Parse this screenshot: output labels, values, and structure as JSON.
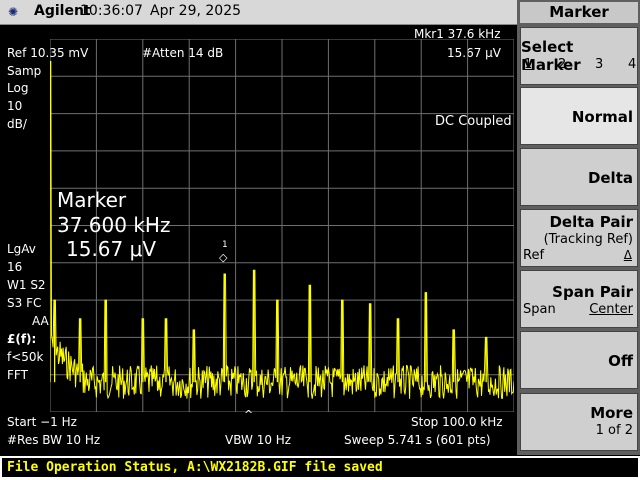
{
  "header": {
    "logo_icon": "agilent-spark-icon",
    "brand": "Agilent",
    "time": "10:36:07",
    "date": "Apr 29, 2025"
  },
  "analyzer": {
    "mkr_readout": "Mkr1  37.6 kHz",
    "ref_level": "Ref 10.35 mV",
    "atten": "#Atten 14 dB",
    "mkr_amplitude": "15.67 μV",
    "left_labels": [
      "Samp",
      "Log",
      "10",
      "dB/"
    ],
    "dc_coupled": "DC Coupled",
    "marker_title": "Marker",
    "marker_freq": "37.600 kHz",
    "marker_amp": "15.67 μV",
    "marker_id": "1",
    "lgav": "LgAv",
    "lgav_count": "16",
    "w1": "W1  S2",
    "s3": "S3  FC",
    "aa": "AA",
    "ff": "£(f):",
    "f50k": "f<50k",
    "fft": "FFT",
    "start": "Start −1 Hz",
    "stop": "Stop 100.0 kHz",
    "res_bw": "#Res BW 10 Hz",
    "vbw": "VBW 10 Hz",
    "sweep": "Sweep 5.741 s (601 pts)"
  },
  "chart_data": {
    "type": "line",
    "title": "",
    "xlabel": "",
    "ylabel": "",
    "x_unit": "kHz",
    "xlim": [
      0,
      100
    ],
    "y_divisions_from_top": [
      0,
      10
    ],
    "grid": true,
    "trace_color": "#ffff00",
    "baseline_div": 9.2,
    "peaks": [
      {
        "x": 0.0,
        "div": 0.6
      },
      {
        "x": 1.0,
        "div": 7.0
      },
      {
        "x": 6.5,
        "div": 7.5
      },
      {
        "x": 12.0,
        "div": 7.0
      },
      {
        "x": 20.0,
        "div": 7.5
      },
      {
        "x": 25.0,
        "div": 7.5
      },
      {
        "x": 31.0,
        "div": 7.8
      },
      {
        "x": 37.6,
        "div": 6.3
      },
      {
        "x": 44.0,
        "div": 6.2
      },
      {
        "x": 49.0,
        "div": 7.0
      },
      {
        "x": 56.0,
        "div": 6.6
      },
      {
        "x": 63.0,
        "div": 7.0
      },
      {
        "x": 69.0,
        "div": 7.1
      },
      {
        "x": 75.0,
        "div": 7.5
      },
      {
        "x": 81.0,
        "div": 6.8
      },
      {
        "x": 87.0,
        "div": 7.8
      },
      {
        "x": 94.0,
        "div": 8.0
      }
    ]
  },
  "softkeys": {
    "title": "Marker",
    "select_marker": "Select Marker",
    "marker_numbers": [
      "1",
      "2",
      "3",
      "4"
    ],
    "normal": "Normal",
    "delta": "Delta",
    "delta_pair": "Delta Pair",
    "tracking_ref": "(Tracking Ref)",
    "ref_label": "Ref",
    "delta_indicator": "Δ",
    "span_pair": "Span Pair",
    "span_label": "Span",
    "center_label": "Center",
    "off": "Off",
    "more": "More",
    "more_page": "1 of 2"
  },
  "status_bar": {
    "text": "File Operation Status, A:\\WX2182B.GIF file saved"
  }
}
